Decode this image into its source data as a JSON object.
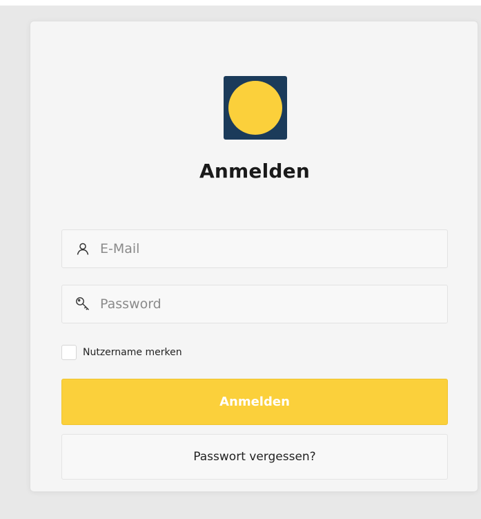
{
  "login": {
    "title": "Anmelden",
    "email": {
      "placeholder": "E-Mail",
      "value": "",
      "icon": "user-icon"
    },
    "password": {
      "placeholder": "Password",
      "value": "",
      "icon": "key-icon"
    },
    "remember_label": "Nutzername merken",
    "remember_checked": false,
    "submit_label": "Anmelden",
    "forgot_label": "Passwort vergessen?"
  },
  "colors": {
    "accent": "#fbd03b",
    "logo_bg": "#1b3b5a",
    "card_bg": "#f5f5f5"
  }
}
